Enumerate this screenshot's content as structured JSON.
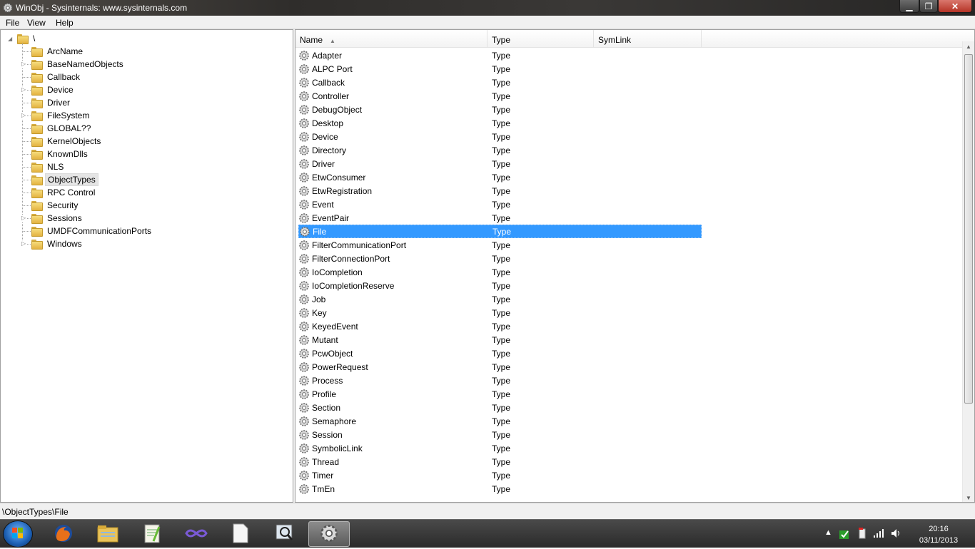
{
  "window": {
    "title": "WinObj - Sysinternals: www.sysinternals.com",
    "min_glyph": "▁",
    "max_glyph": "❐",
    "close_glyph": "✕"
  },
  "menu": [
    {
      "label": "File"
    },
    {
      "label": "View"
    },
    {
      "label": "Help"
    }
  ],
  "tree": {
    "root": "\\",
    "items": [
      {
        "label": "ArcName",
        "expandable": false
      },
      {
        "label": "BaseNamedObjects",
        "expandable": true
      },
      {
        "label": "Callback",
        "expandable": false
      },
      {
        "label": "Device",
        "expandable": true
      },
      {
        "label": "Driver",
        "expandable": false
      },
      {
        "label": "FileSystem",
        "expandable": true
      },
      {
        "label": "GLOBAL??",
        "expandable": false
      },
      {
        "label": "KernelObjects",
        "expandable": false
      },
      {
        "label": "KnownDlls",
        "expandable": false
      },
      {
        "label": "NLS",
        "expandable": false
      },
      {
        "label": "ObjectTypes",
        "expandable": false,
        "selected": true
      },
      {
        "label": "RPC Control",
        "expandable": false
      },
      {
        "label": "Security",
        "expandable": false
      },
      {
        "label": "Sessions",
        "expandable": true
      },
      {
        "label": "UMDFCommunicationPorts",
        "expandable": false
      },
      {
        "label": "Windows",
        "expandable": true
      }
    ]
  },
  "list": {
    "columns": [
      {
        "label": "Name",
        "sort": "▲"
      },
      {
        "label": "Type"
      },
      {
        "label": "SymLink"
      }
    ],
    "rows": [
      {
        "name": "Adapter",
        "type": "Type"
      },
      {
        "name": "ALPC Port",
        "type": "Type"
      },
      {
        "name": "Callback",
        "type": "Type"
      },
      {
        "name": "Controller",
        "type": "Type"
      },
      {
        "name": "DebugObject",
        "type": "Type"
      },
      {
        "name": "Desktop",
        "type": "Type"
      },
      {
        "name": "Device",
        "type": "Type"
      },
      {
        "name": "Directory",
        "type": "Type"
      },
      {
        "name": "Driver",
        "type": "Type"
      },
      {
        "name": "EtwConsumer",
        "type": "Type"
      },
      {
        "name": "EtwRegistration",
        "type": "Type"
      },
      {
        "name": "Event",
        "type": "Type"
      },
      {
        "name": "EventPair",
        "type": "Type"
      },
      {
        "name": "File",
        "type": "Type",
        "selected": true
      },
      {
        "name": "FilterCommunicationPort",
        "type": "Type"
      },
      {
        "name": "FilterConnectionPort",
        "type": "Type"
      },
      {
        "name": "IoCompletion",
        "type": "Type"
      },
      {
        "name": "IoCompletionReserve",
        "type": "Type"
      },
      {
        "name": "Job",
        "type": "Type"
      },
      {
        "name": "Key",
        "type": "Type"
      },
      {
        "name": "KeyedEvent",
        "type": "Type"
      },
      {
        "name": "Mutant",
        "type": "Type"
      },
      {
        "name": "PcwObject",
        "type": "Type"
      },
      {
        "name": "PowerRequest",
        "type": "Type"
      },
      {
        "name": "Process",
        "type": "Type"
      },
      {
        "name": "Profile",
        "type": "Type"
      },
      {
        "name": "Section",
        "type": "Type"
      },
      {
        "name": "Semaphore",
        "type": "Type"
      },
      {
        "name": "Session",
        "type": "Type"
      },
      {
        "name": "SymbolicLink",
        "type": "Type"
      },
      {
        "name": "Thread",
        "type": "Type"
      },
      {
        "name": "Timer",
        "type": "Type"
      },
      {
        "name": "TmEn",
        "type": "Type"
      }
    ],
    "selection_color": "#3399ff"
  },
  "status": {
    "path": "\\ObjectTypes\\File"
  },
  "taskbar": {
    "items": [
      {
        "icon": "firefox-icon"
      },
      {
        "icon": "explorer-icon"
      },
      {
        "icon": "notepadpp-icon"
      },
      {
        "icon": "visual-studio-icon"
      },
      {
        "icon": "blank-document-icon"
      },
      {
        "icon": "magnifier-icon"
      },
      {
        "icon": "winobj-gear-icon",
        "active": true
      }
    ],
    "clock_time": "20:16",
    "clock_date": "03/11/2013"
  }
}
